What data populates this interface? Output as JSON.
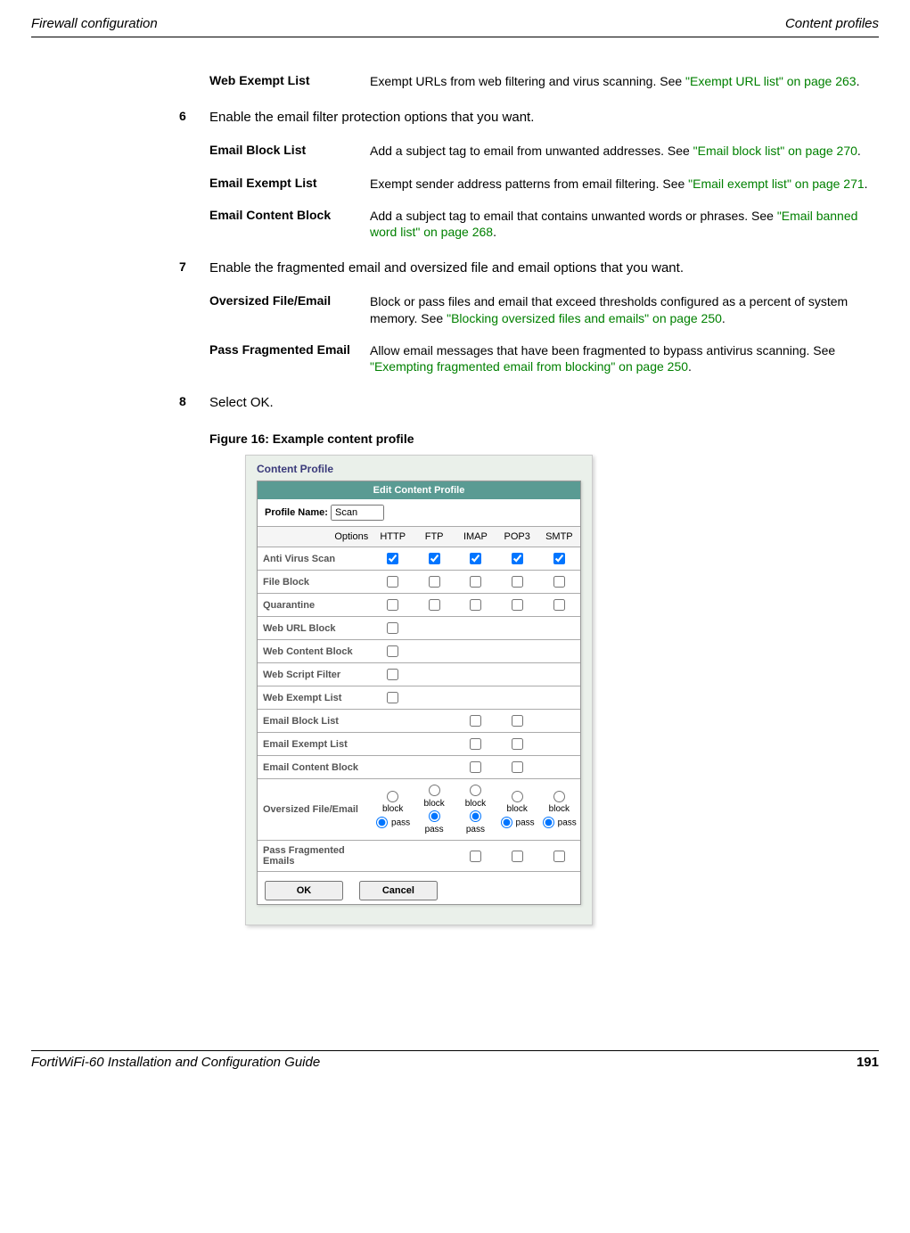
{
  "header": {
    "left": "Firewall configuration",
    "right": "Content profiles"
  },
  "rows": [
    {
      "term": "Web Exempt List",
      "descA": "Exempt URLs from web filtering and virus scanning. See ",
      "link": "\"Exempt URL list\" on page 263",
      "descB": "."
    }
  ],
  "step6": {
    "num": "6",
    "text": "Enable the email filter protection options that you want."
  },
  "emailRows": [
    {
      "term": "Email Block List",
      "descA": "Add a subject tag to email from unwanted addresses. See ",
      "link": "\"Email block list\" on page 270",
      "descB": "."
    },
    {
      "term": "Email Exempt List",
      "descA": "Exempt sender address patterns from email filtering. See ",
      "link": "\"Email exempt list\" on page 271",
      "descB": "."
    },
    {
      "term": "Email Content Block",
      "descA": "Add a subject tag to email that contains unwanted words or phrases. See ",
      "link": "\"Email banned word list\" on page 268",
      "descB": "."
    }
  ],
  "step7": {
    "num": "7",
    "text": "Enable the fragmented email and oversized file and email options that you want."
  },
  "fragRows": [
    {
      "term": "Oversized File/Email",
      "descA": "Block or pass files and email that exceed thresholds configured as a percent of system memory. See ",
      "link": "\"Blocking oversized files and emails\" on page 250",
      "descB": "."
    },
    {
      "term": "Pass Fragmented Email",
      "descA": "Allow email messages that have been fragmented to bypass antivirus scanning. See ",
      "link": "\"Exempting fragmented email from blocking\" on page 250",
      "descB": "."
    }
  ],
  "step8": {
    "num": "8",
    "text": "Select OK."
  },
  "figureCaption": "Figure 16: Example content profile",
  "fig": {
    "title": "Content Profile",
    "barTitle": "Edit Content Profile",
    "profileLabel": "Profile Name:",
    "profileValue": "Scan",
    "headers": [
      "Options",
      "HTTP",
      "FTP",
      "IMAP",
      "POP3",
      "SMTP"
    ],
    "optRows": [
      {
        "label": "Anti Virus Scan",
        "cells": [
          "c1",
          "c1",
          "c1",
          "c1",
          "c1"
        ]
      },
      {
        "label": "File Block",
        "cells": [
          "c0",
          "c0",
          "c0",
          "c0",
          "c0"
        ]
      },
      {
        "label": "Quarantine",
        "cells": [
          "c0",
          "c0",
          "c0",
          "c0",
          "c0"
        ]
      },
      {
        "label": "Web URL Block",
        "cells": [
          "c0",
          "",
          "",
          "",
          ""
        ]
      },
      {
        "label": "Web Content Block",
        "cells": [
          "c0",
          "",
          "",
          "",
          ""
        ]
      },
      {
        "label": "Web Script Filter",
        "cells": [
          "c0",
          "",
          "",
          "",
          ""
        ]
      },
      {
        "label": "Web Exempt List",
        "cells": [
          "c0",
          "",
          "",
          "",
          ""
        ]
      },
      {
        "label": "Email Block List",
        "cells": [
          "",
          "",
          "c0",
          "c0",
          ""
        ]
      },
      {
        "label": "Email Exempt List",
        "cells": [
          "",
          "",
          "c0",
          "c0",
          ""
        ]
      },
      {
        "label": "Email Content Block",
        "cells": [
          "",
          "",
          "c0",
          "c0",
          ""
        ]
      },
      {
        "label": "Oversized File/Email",
        "cells": [
          "bp",
          "bp",
          "bp",
          "bp",
          "bp"
        ]
      },
      {
        "label": "Pass Fragmented Emails",
        "cells": [
          "",
          "",
          "c0",
          "c0",
          "c0"
        ]
      }
    ],
    "blockLabel": "block",
    "passLabel": "pass",
    "okBtn": "OK",
    "cancelBtn": "Cancel"
  },
  "footer": {
    "left": "FortiWiFi-60 Installation and Configuration Guide",
    "page": "191"
  }
}
